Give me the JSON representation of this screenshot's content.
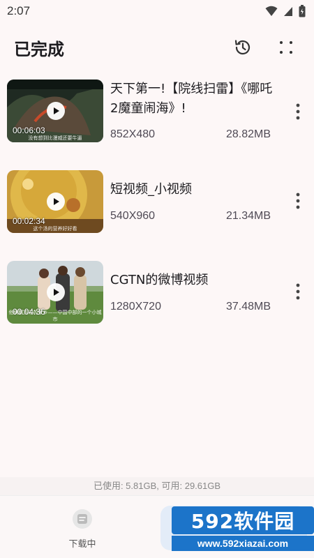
{
  "status": {
    "time": "2:07"
  },
  "header": {
    "title": "已完成",
    "history_icon": "history-icon",
    "more_icon": "more-vert-icon"
  },
  "items": [
    {
      "title": "天下第一!【院线扫雷】《哪吒2魔童闹海》!",
      "duration": "00:06:03",
      "resolution": "852X480",
      "size": "28.82MB",
      "thumb_caption": "没有想到比漫威还要牛逼"
    },
    {
      "title": "短视频_小视频",
      "duration": "00:02:34",
      "resolution": "540X960",
      "size": "21.34MB",
      "thumb_caption": "这个汤的营养好好看"
    },
    {
      "title": "CGTN的微博视频",
      "duration": "00:04:36",
      "resolution": "1280X720",
      "size": "37.48MB",
      "thumb_caption": "他俩聊去过的家乡——中国中部的一个小城市"
    }
  ],
  "storage": {
    "text": "已使用: 5.81GB, 可用: 29.61GB"
  },
  "nav": {
    "downloading_label": "下载中"
  },
  "watermark": {
    "brand": "592软件园",
    "url": "www.592xiazai.com"
  },
  "colors": {
    "accent": "#1c74c9",
    "background": "#fdf7f7",
    "nav_selected": "#e3ecf8"
  }
}
